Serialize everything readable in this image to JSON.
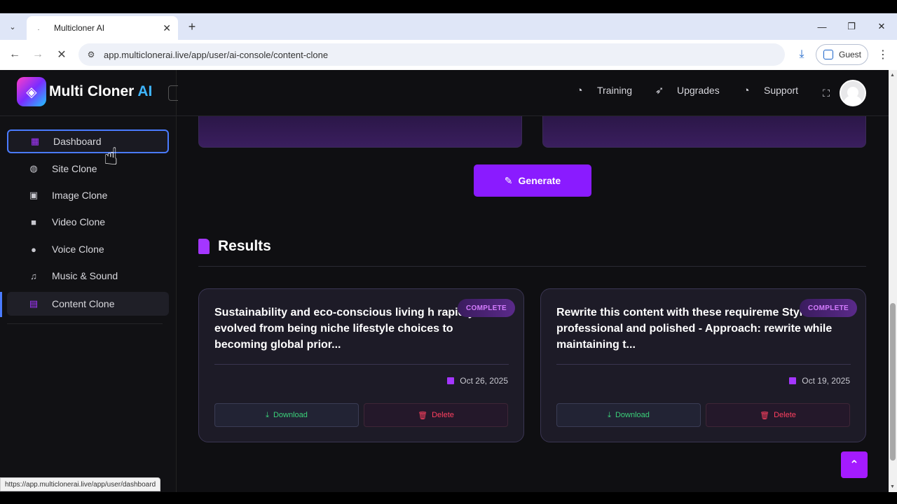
{
  "browser": {
    "tab_title": "Multicloner AI",
    "new_tab": "+",
    "url": "app.multiclonerai.live/app/user/ai-console/content-clone",
    "profile_label": "Guest",
    "status_url": "https://app.multiclonerai.live/app/user/dashboard"
  },
  "brand": {
    "name": "Multi Cloner",
    "ai": "AI"
  },
  "sidebar": {
    "items": [
      {
        "label": "Dashboard",
        "icon": "dashboard-icon"
      },
      {
        "label": "Site Clone",
        "icon": "globe-icon"
      },
      {
        "label": "Image Clone",
        "icon": "image-icon"
      },
      {
        "label": "Video Clone",
        "icon": "video-icon"
      },
      {
        "label": "Voice Clone",
        "icon": "microphone-icon"
      },
      {
        "label": "Music & Sound",
        "icon": "music-icon"
      },
      {
        "label": "Content Clone",
        "icon": "document-icon"
      }
    ]
  },
  "topnav": {
    "training": "Training",
    "upgrades": "Upgrades",
    "support": "Support"
  },
  "main": {
    "generate_label": "Generate",
    "results_title": "Results",
    "cards": [
      {
        "text": "Sustainability and eco-conscious living h rapidly evolved from being niche lifestyle choices to becoming global prior...",
        "badge": "COMPLETE",
        "date": "Oct 26, 2025",
        "download": "Download",
        "delete": "Delete"
      },
      {
        "text": "Rewrite this content with these requireme Style: professional and polished - Approach: rewrite while maintaining t...",
        "badge": "COMPLETE",
        "date": "Oct 19, 2025",
        "download": "Download",
        "delete": "Delete"
      }
    ]
  },
  "colors": {
    "accent": "#8a1bff",
    "hover_border": "#4a7bff",
    "download_green": "#3bd17a",
    "delete_red": "#ff4060"
  }
}
